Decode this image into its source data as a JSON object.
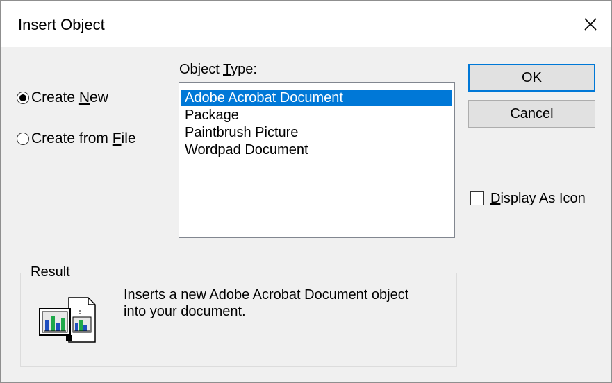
{
  "window": {
    "title": "Insert Object"
  },
  "options": {
    "create_new": {
      "prefix": "Create ",
      "accel": "N",
      "suffix": "ew",
      "checked": true
    },
    "create_from_file": {
      "prefix": "Create from ",
      "accel": "F",
      "suffix": "ile",
      "checked": false
    }
  },
  "object_type": {
    "label_prefix": "Object ",
    "label_accel": "T",
    "label_suffix": "ype:",
    "items": [
      "Adobe Acrobat Document",
      "Package",
      "Paintbrush Picture",
      "Wordpad Document"
    ],
    "selected_index": 0
  },
  "buttons": {
    "ok": "OK",
    "cancel": "Cancel"
  },
  "display_as_icon": {
    "accel": "D",
    "suffix": "isplay As Icon",
    "checked": false
  },
  "result": {
    "legend": "Result",
    "line1": "Inserts a new Adobe Acrobat Document object",
    "line2": "into your document."
  },
  "icons": {
    "close": "close-icon",
    "result": "object-document-icon"
  },
  "colors": {
    "accent": "#0078d7",
    "dialog_bg": "#f0f0f0"
  }
}
